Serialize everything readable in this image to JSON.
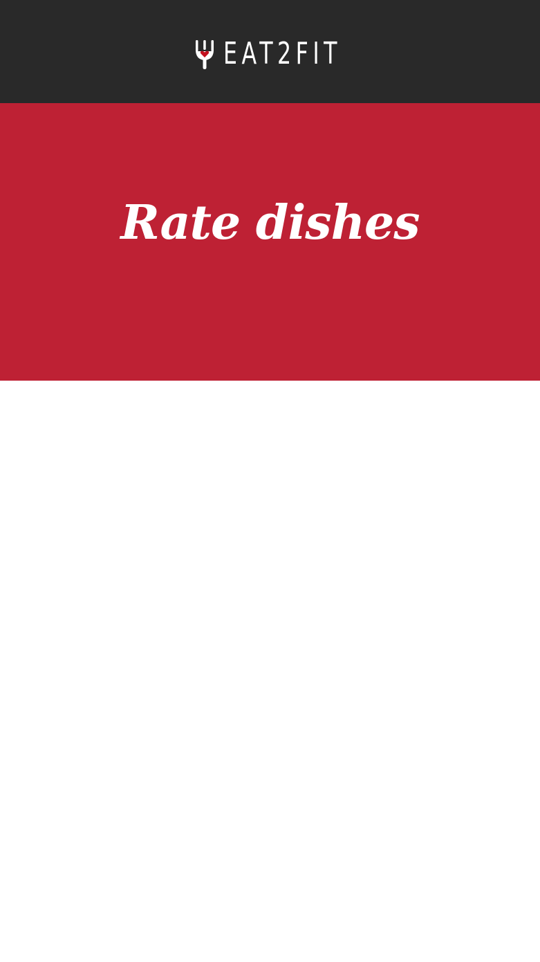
{
  "header": {
    "logo_text": "EAT2FIT",
    "logo_icon": "fork-heart-icon",
    "background_color": "#292929"
  },
  "hero": {
    "title": "Rate dishes",
    "background_color": "#be2134",
    "text_color": "#ffffff"
  },
  "colors": {
    "accent": "#be2134",
    "heart": "#c3111f",
    "page_background": "#ffffff"
  }
}
